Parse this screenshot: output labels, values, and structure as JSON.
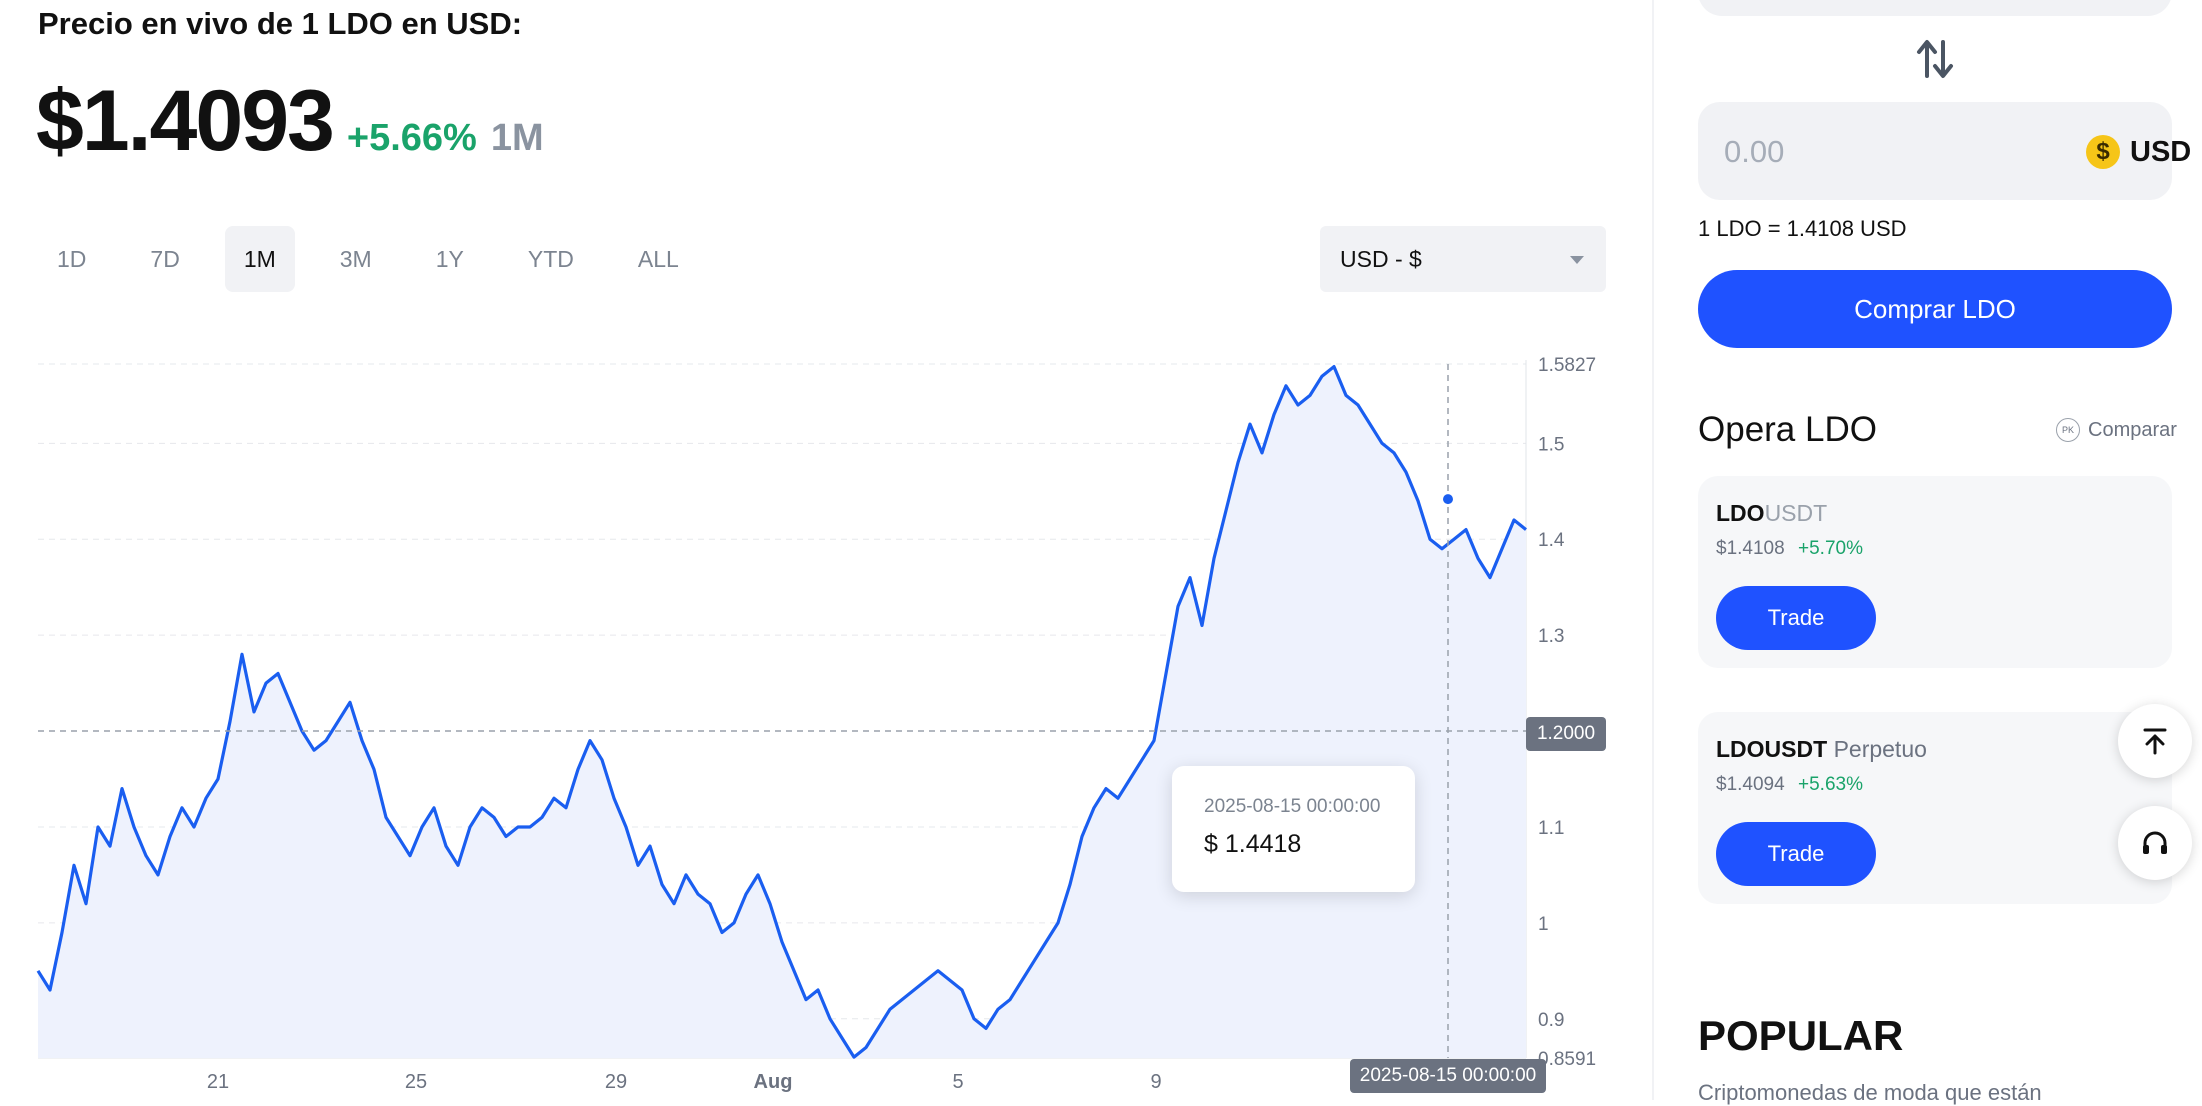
{
  "header": {
    "title": "Precio en vivo de 1 LDO en USD:",
    "price": "$1.4093",
    "change": "+5.66%",
    "range": "1M"
  },
  "tabs": [
    "1D",
    "7D",
    "1M",
    "3M",
    "1Y",
    "YTD",
    "ALL"
  ],
  "active_tab": "1M",
  "currency_select": {
    "value": "USD - $"
  },
  "tooltip": {
    "date": "2025-08-15 00:00:00",
    "value": "$ 1.4418"
  },
  "crosshair": {
    "y_label": "1.2000",
    "x_label": "2025-08-15 00:00:00"
  },
  "chart_data": {
    "type": "line",
    "series": [
      {
        "values": [
          0.95,
          0.93,
          0.99,
          1.06,
          1.02,
          1.1,
          1.08,
          1.14,
          1.1,
          1.07,
          1.05,
          1.09,
          1.12,
          1.1,
          1.13,
          1.15,
          1.21,
          1.28,
          1.22,
          1.25,
          1.26,
          1.23,
          1.2,
          1.18,
          1.19,
          1.21,
          1.23,
          1.19,
          1.16,
          1.11,
          1.09,
          1.07,
          1.1,
          1.12,
          1.08,
          1.06,
          1.1,
          1.12,
          1.11,
          1.09,
          1.1,
          1.1,
          1.11,
          1.13,
          1.12,
          1.16,
          1.19,
          1.17,
          1.13,
          1.1,
          1.06,
          1.08,
          1.04,
          1.02,
          1.05,
          1.03,
          1.02,
          0.99,
          1.0,
          1.03,
          1.05,
          1.02,
          0.98,
          0.95,
          0.92,
          0.93,
          0.9,
          0.88,
          0.86,
          0.87,
          0.89,
          0.91,
          0.92,
          0.93,
          0.94,
          0.95,
          0.94,
          0.93,
          0.9,
          0.89,
          0.91,
          0.92,
          0.94,
          0.96,
          0.98,
          1.0,
          1.04,
          1.09,
          1.12,
          1.14,
          1.13,
          1.15,
          1.17,
          1.19,
          1.26,
          1.33,
          1.36,
          1.31,
          1.38,
          1.43,
          1.48,
          1.52,
          1.49,
          1.53,
          1.56,
          1.54,
          1.55,
          1.57,
          1.58,
          1.55,
          1.54,
          1.52,
          1.5,
          1.49,
          1.47,
          1.44,
          1.4,
          1.39,
          1.4,
          1.41,
          1.38,
          1.36,
          1.39,
          1.42,
          1.41
        ]
      }
    ],
    "x_tick_labels": [
      "21",
      "25",
      "29",
      "Aug",
      "5",
      "9"
    ],
    "y_tick_labels": [
      "1.5827",
      "1.5",
      "1.4",
      "1.3",
      "1.1",
      "1",
      "0.9",
      "0.8591"
    ],
    "ylim": [
      0.8591,
      1.5827
    ],
    "grid": true,
    "line_color": "#1a5ef0",
    "area_color": "#eef2fd"
  },
  "converter": {
    "amount": "0.00",
    "coin_symbol": "$",
    "currency": "USD",
    "rate": "1 LDO = 1.4108 USD",
    "buy_label": "Comprar LDO"
  },
  "trade_section": {
    "title": "Opera LDO",
    "compare_badge": "PK",
    "compare_label": "Comparar",
    "cards": [
      {
        "base": "LDO",
        "quote": "USDT",
        "suffix": "",
        "price": "$1.4108",
        "change": "+5.70%",
        "button": "Trade"
      },
      {
        "base": "LDOUSDT",
        "quote": "",
        "suffix": "Perpetuo",
        "price": "$1.4094",
        "change": "+5.63%",
        "button": "Trade"
      }
    ]
  },
  "popular": {
    "title": "POPULAR",
    "subtitle": "Criptomonedas de moda que están"
  },
  "icons": {
    "swap": "swap-vertical-icon",
    "scroll_top": "arrow-up-to-top-icon",
    "support": "headset-icon"
  }
}
